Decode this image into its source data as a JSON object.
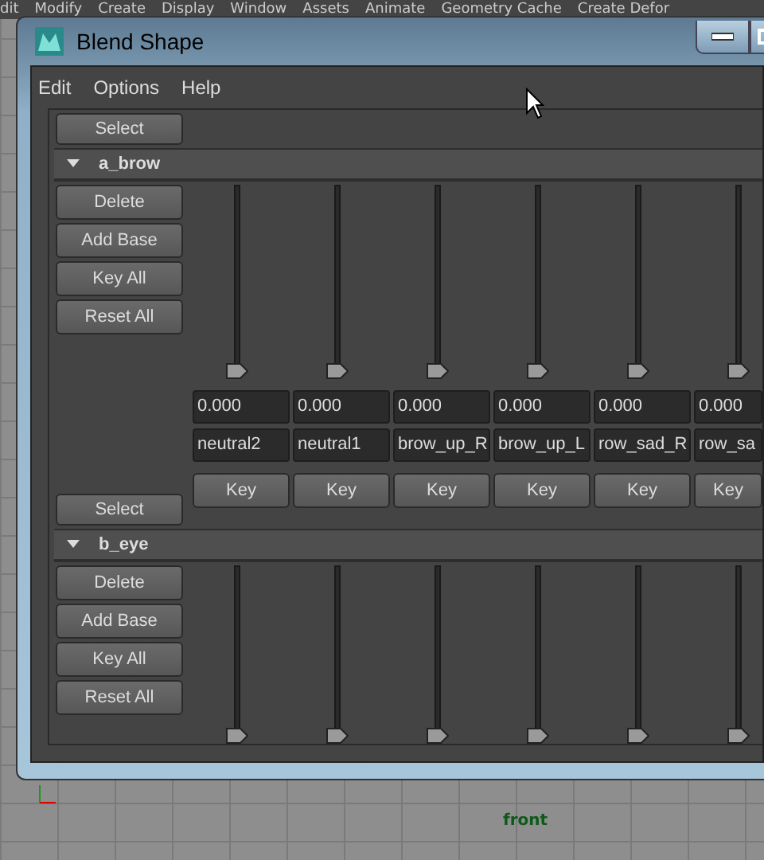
{
  "app_menu": [
    "dit",
    "Modify",
    "Create",
    "Display",
    "Window",
    "Assets",
    "Animate",
    "Geometry Cache",
    "Create Defor"
  ],
  "viewport": {
    "label": "front"
  },
  "window": {
    "title": "Blend Shape",
    "menu": [
      "Edit",
      "Options",
      "Help"
    ],
    "groups": [
      {
        "select": "Select",
        "name": "a_brow",
        "expanded": true,
        "buttons": [
          "Delete",
          "Add Base",
          "Key All",
          "Reset All"
        ],
        "sliders": [
          {
            "level": 0,
            "value": "0.000",
            "name": "neutral2",
            "key": "Key"
          },
          {
            "level": 0,
            "value": "0.000",
            "name": "neutral1",
            "key": "Key"
          },
          {
            "level": 0,
            "value": "0.000",
            "name": "brow_up_R",
            "key": "Key"
          },
          {
            "level": 0,
            "value": "0.000",
            "name": "brow_up_L",
            "key": "Key"
          },
          {
            "level": 0,
            "value": "0.000",
            "name": "row_sad_R",
            "key": "Key"
          },
          {
            "level": 0,
            "value": "0.000",
            "name": "row_sa",
            "key": "Key"
          }
        ]
      },
      {
        "select": "Select",
        "name": "b_eye",
        "expanded": true,
        "buttons": [
          "Delete",
          "Add Base",
          "Key All",
          "Reset All"
        ],
        "sliders": [
          {
            "level": 0
          },
          {
            "level": 0
          },
          {
            "level": 0
          },
          {
            "level": 0
          },
          {
            "level": 0
          },
          {
            "level": 0
          }
        ]
      }
    ]
  }
}
